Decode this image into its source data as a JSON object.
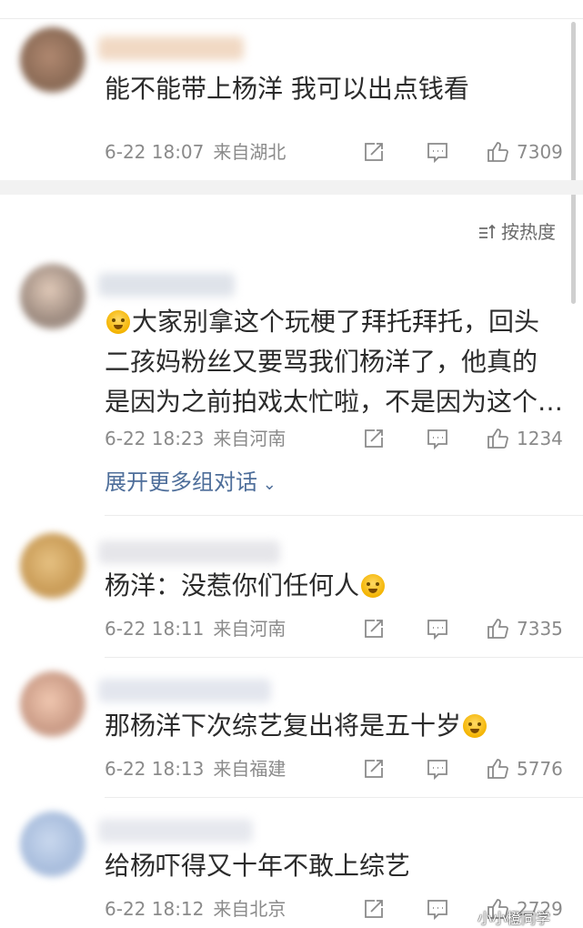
{
  "sort": {
    "label": "按热度"
  },
  "expand": {
    "label": "展开更多组对话",
    "chevron": "chevron-down-icon"
  },
  "watermark": "小小橙同学",
  "colors": {
    "link": "#4e6e9a",
    "meta": "#8a8a8a",
    "separator": "#f2f2f2"
  },
  "comments": [
    {
      "text": "能不能带上杨洋 我可以出点钱看",
      "date": "6-22 18:07",
      "location": "来自湖北",
      "likes": "7309"
    },
    {
      "lines": [
        "大家别拿这个玩梗了拜托拜托，回头",
        "二孩妈粉丝又要骂我们杨洋了，他真的",
        "是因为之前拍戏太忙啦，不是因为这个…"
      ],
      "date": "6-22 18:23",
      "location": "来自河南",
      "likes": "1234"
    },
    {
      "text": "杨洋：没惹你们任何人",
      "date": "6-22 18:11",
      "location": "来自河南",
      "likes": "7335"
    },
    {
      "text": "那杨洋下次综艺复出将是五十岁",
      "date": "6-22 18:13",
      "location": "来自福建",
      "likes": "5776"
    },
    {
      "text": "给杨吓得又十年不敢上综艺",
      "date": "6-22 18:12",
      "location": "来自北京",
      "likes": "2729"
    }
  ]
}
